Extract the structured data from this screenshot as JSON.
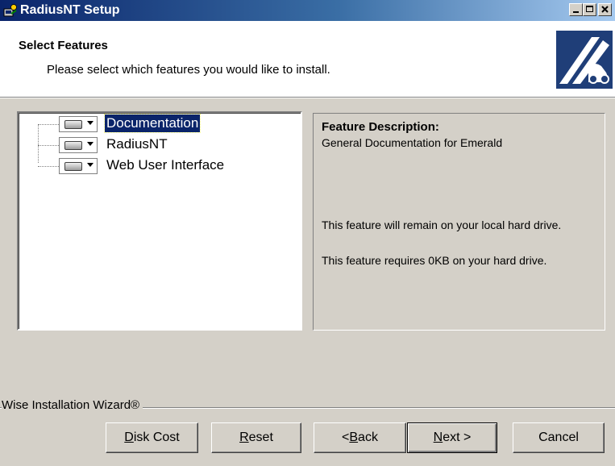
{
  "window": {
    "title": "RadiusNT Setup"
  },
  "header": {
    "title": "Select Features",
    "subtitle": "Please select which features you would like to install."
  },
  "features": [
    {
      "label": "Documentation",
      "selected": true
    },
    {
      "label": "RadiusNT",
      "selected": false
    },
    {
      "label": "Web User Interface",
      "selected": false
    }
  ],
  "description": {
    "title": "Feature Description:",
    "text": "General Documentation for Emerald",
    "remain": "This feature will remain on your local hard drive.",
    "requires": "This feature requires 0KB on your hard drive."
  },
  "footer": {
    "brand": "Wise Installation Wizard®"
  },
  "buttons": {
    "disk_cost": {
      "pre": "",
      "accel": "D",
      "post": "isk Cost"
    },
    "reset": {
      "pre": "",
      "accel": "R",
      "post": "eset"
    },
    "back": {
      "pre": "< ",
      "accel": "B",
      "post": "ack"
    },
    "next": {
      "pre": "",
      "accel": "N",
      "post": "ext >"
    },
    "cancel": {
      "label": "Cancel"
    }
  }
}
